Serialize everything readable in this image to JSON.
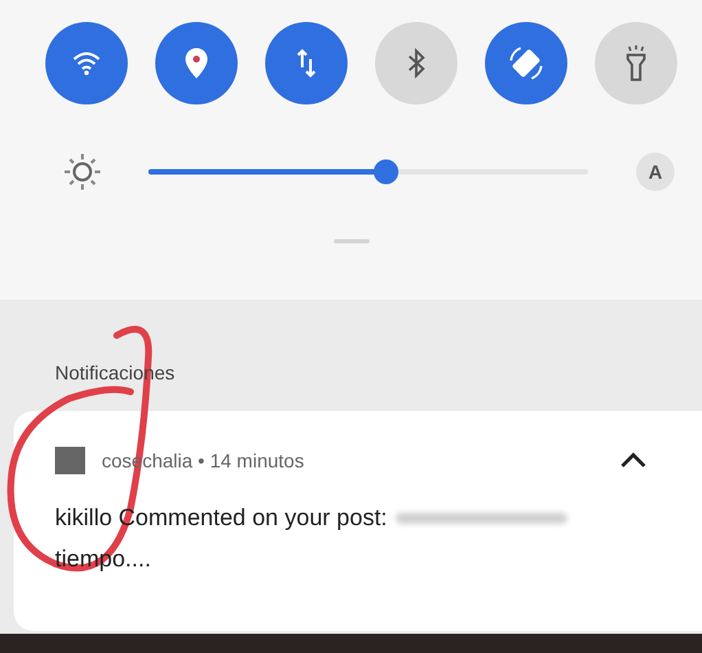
{
  "quick_toggles": [
    {
      "on": true
    },
    {
      "on": true
    },
    {
      "on": true
    },
    {
      "on": false
    },
    {
      "on": true
    },
    {
      "on": false
    }
  ],
  "brightness": {
    "level": 0.54,
    "auto_label": "A"
  },
  "notifications": {
    "heading": "Notificaciones",
    "items": [
      {
        "header": "cosechalia • 14 minutos",
        "expanded": true,
        "message": "kikillo Commented on your post:",
        "message_end": "tiempo...."
      }
    ]
  }
}
